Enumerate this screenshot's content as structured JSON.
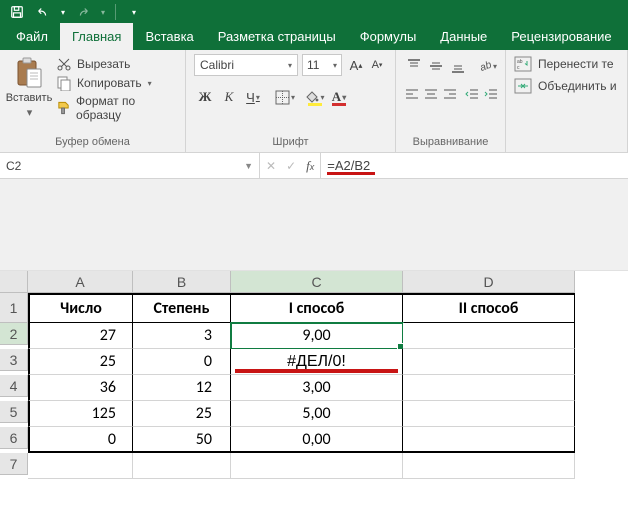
{
  "qat": {
    "save": "save",
    "undo": "undo",
    "redo": "redo"
  },
  "tabs": {
    "file": "Файл",
    "home": "Главная",
    "insert": "Вставка",
    "layout": "Разметка страницы",
    "formulas": "Формулы",
    "data": "Данные",
    "review": "Рецензирование"
  },
  "ribbon": {
    "clipboard": {
      "paste": "Вставить",
      "cut": "Вырезать",
      "copy": "Копировать",
      "format_painter": "Формат по образцу",
      "group_label": "Буфер обмена"
    },
    "font": {
      "name": "Calibri",
      "size": "11",
      "bold": "Ж",
      "italic": "К",
      "underline": "Ч",
      "group_label": "Шрифт"
    },
    "align": {
      "group_label": "Выравнивание"
    },
    "cells": {
      "wrap": "Перенести те",
      "merge": "Объединить и"
    }
  },
  "formula_bar": {
    "name_box": "C2",
    "formula": "=A2/B2"
  },
  "grid": {
    "col_headers": [
      "A",
      "B",
      "C",
      "D"
    ],
    "row_headers": [
      "1",
      "2",
      "3",
      "4",
      "5",
      "6",
      "7"
    ],
    "header_row": {
      "A": "Число",
      "B": "Степень",
      "C": "I способ",
      "D": "II способ"
    },
    "rows": [
      {
        "A": "27",
        "B": "3",
        "C": "9,00",
        "D": ""
      },
      {
        "A": "25",
        "B": "0",
        "C": "#ДЕЛ/0!",
        "D": ""
      },
      {
        "A": "36",
        "B": "12",
        "C": "3,00",
        "D": ""
      },
      {
        "A": "125",
        "B": "25",
        "C": "5,00",
        "D": ""
      },
      {
        "A": "0",
        "B": "50",
        "C": "0,00",
        "D": ""
      }
    ],
    "selected_cell": "C2",
    "error_cell": "C3"
  }
}
